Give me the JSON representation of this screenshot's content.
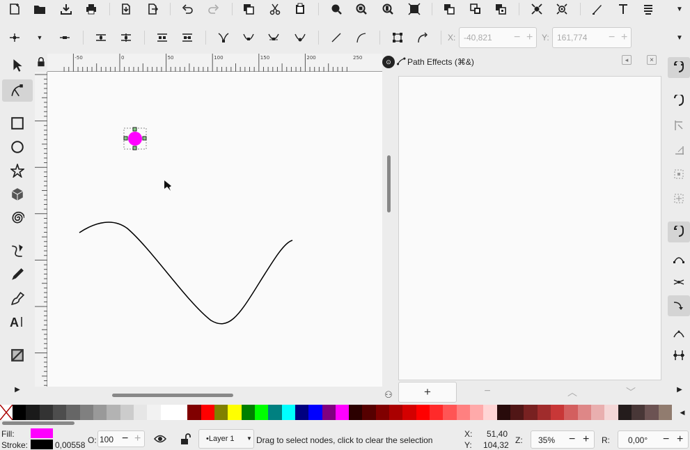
{
  "coords": {
    "x_label": "X:",
    "x_value": "-40,821",
    "y_label": "Y:",
    "y_value": "161,774",
    "minus": "−",
    "plus": "+"
  },
  "ruler": {
    "h_ticks": [
      "-50",
      "0",
      "50",
      "100",
      "150",
      "200",
      "250"
    ]
  },
  "dock": {
    "title": "Path Effects (⌘&)",
    "add": "+",
    "remove": "−",
    "up": "︿",
    "down": "﹀"
  },
  "status": {
    "fill_label": "Fill:",
    "stroke_label": "Stroke:",
    "fill_color": "#ff00ff",
    "stroke_color": "#000000",
    "stroke_width": "0,00558",
    "opacity_label": "O:",
    "opacity_value": "100",
    "layer": "•Layer 1",
    "message": "Drag to select nodes, click to clear the selection",
    "x_label": "X:",
    "x_value": "51,40",
    "y_label": "Y:",
    "y_value": "104,32",
    "zoom_label": "Z:",
    "zoom_value": "35%",
    "rot_label": "R:",
    "rot_value": "0,00°"
  },
  "palette": [
    "#000000",
    "#1a1a1a",
    "#333333",
    "#4d4d4d",
    "#666666",
    "#808080",
    "#999999",
    "#b3b3b3",
    "#cccccc",
    "#e6e6e6",
    "#f2f2f2",
    "#ffffff",
    "#ffffff",
    "#800000",
    "#ff0000",
    "#808000",
    "#ffff00",
    "#008000",
    "#00ff00",
    "#008080",
    "#00ffff",
    "#000080",
    "#0000ff",
    "#800080",
    "#ff00ff",
    "#2b0000",
    "#550000",
    "#800000",
    "#aa0000",
    "#d40000",
    "#ff0000",
    "#ff2a2a",
    "#ff5555",
    "#ff8080",
    "#ffaaaa",
    "#ffd5d5",
    "#280b0b",
    "#501616",
    "#782121",
    "#a02c2c",
    "#c83737",
    "#d35f5f",
    "#de8787",
    "#e9afaf",
    "#f4d7d7",
    "#241c1c",
    "#483737",
    "#6c5353",
    "#917c6f"
  ],
  "icons": {
    "toolbox": [
      "selector-arrow-icon",
      "node-tool-icon",
      "rect-tool-icon",
      "ellipse-tool-icon",
      "star-tool-icon",
      "3dbox-tool-icon",
      "spiral-tool-icon",
      "bezier-tool-icon",
      "pencil-tool-icon",
      "calligraphy-tool-icon",
      "text-tool-icon",
      "gradient-tool-icon"
    ]
  }
}
